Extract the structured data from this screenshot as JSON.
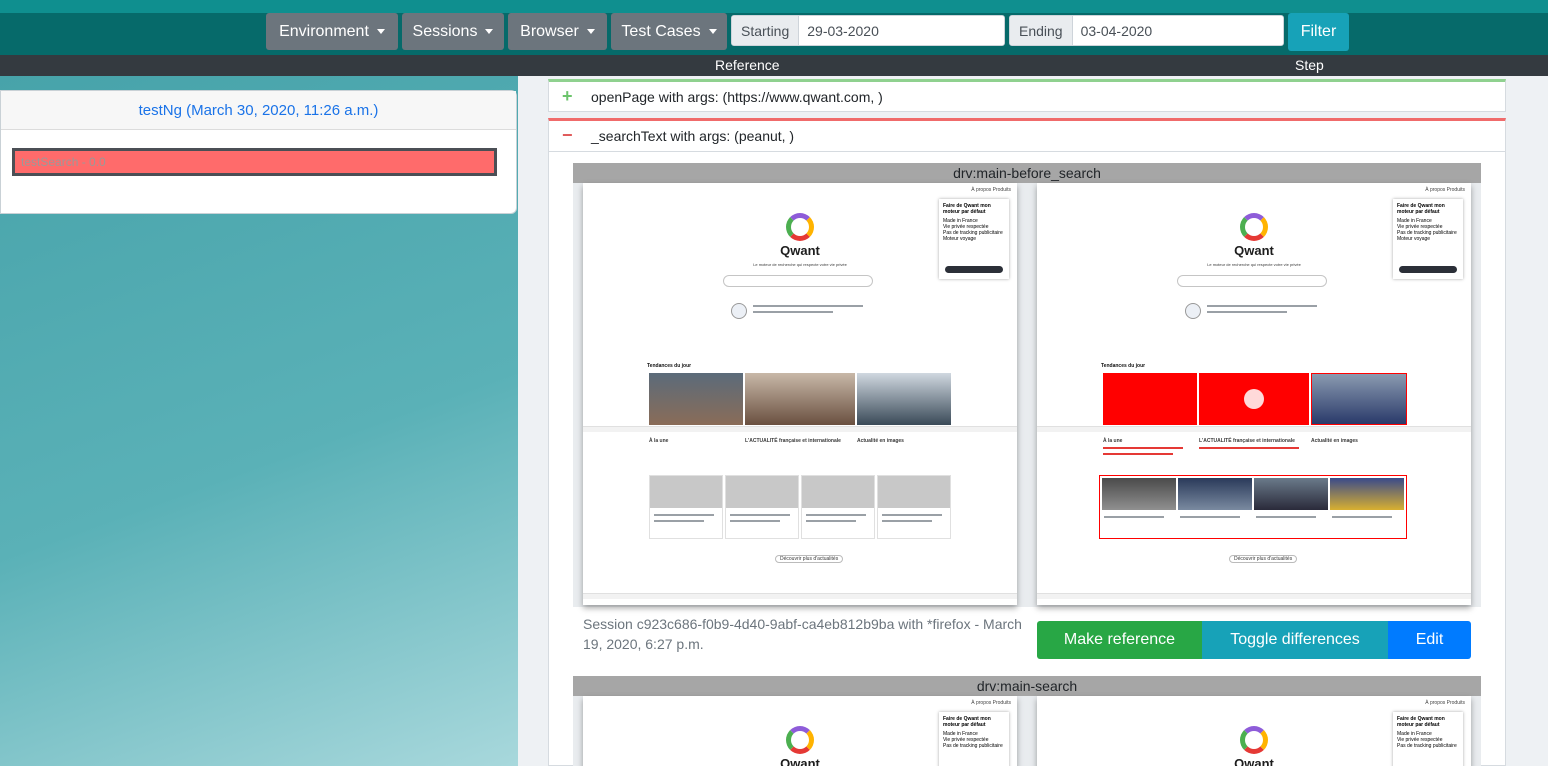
{
  "navbar": {
    "dropdowns": [
      {
        "label": "Environment"
      },
      {
        "label": "Sessions"
      },
      {
        "label": "Browser"
      },
      {
        "label": "Test Cases"
      }
    ],
    "starting": {
      "label": "Starting",
      "value": "29-03-2020"
    },
    "ending": {
      "label": "Ending",
      "value": "03-04-2020"
    },
    "filter_label": "Filter"
  },
  "subheader": {
    "reference": "Reference",
    "step": "Step"
  },
  "testcard": {
    "title": "testNg (March 30, 2020, 11:26 a.m.)",
    "test_label": "testSearch - 0.0"
  },
  "steps": [
    {
      "icon": "+",
      "text": "openPage with args: (https://www.qwant.com, )",
      "status_color": "#8fd18f"
    },
    {
      "icon": "−",
      "text": "_searchText with args: (peanut, )",
      "status_color": "#f06b6b"
    }
  ],
  "captures": [
    {
      "name": "drv:main-before_search"
    },
    {
      "name": "drv:main-search"
    }
  ],
  "screenshot_content": {
    "topbar": "À propos   Produits",
    "popup_title": "Faire de Qwant mon moteur par défaut",
    "popup_items": [
      "Made in France",
      "Vie privée respectée",
      "Pas de tracking publicitaire",
      "Moteur voyage"
    ],
    "popup_button": "Ajouter Qwant à Firefox",
    "logo": "Qwant",
    "tagline": "Le moteur de recherche qui respecte votre vie privée",
    "trends_heading": "Tendances du jour",
    "sections": [
      "À la une",
      "L'ACTUALITÉ française et internationale",
      "Actualité en images"
    ],
    "more_news": "Découvrir plus d'actualités"
  },
  "session_text": "Session c923c686-f0b9-4d40-9abf-ca4eb812b9ba with *firefox - March 19, 2020, 6:27 p.m.",
  "actions": {
    "make_reference": "Make reference",
    "toggle_differences": "Toggle differences",
    "edit": "Edit"
  },
  "colors": {
    "nav_bg": "#066a6a",
    "subbar_bg": "#343a40",
    "fail_red": "#ff6b6b",
    "success": "#28a745",
    "info": "#17a2b8",
    "primary": "#007bff",
    "diff_red": "#ff0000"
  }
}
